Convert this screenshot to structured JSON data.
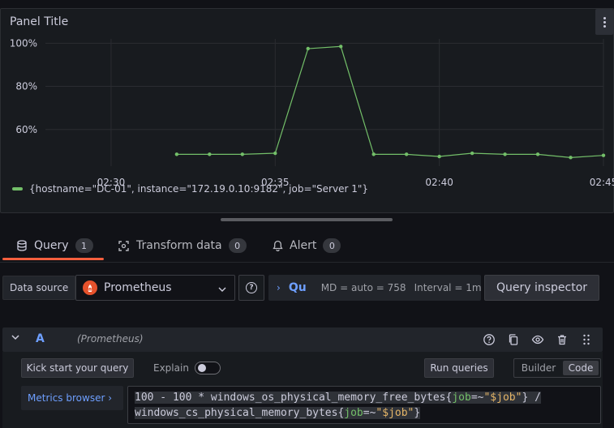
{
  "panel": {
    "title": "Panel Title",
    "legend_label": "{hostname=\"DC-01\", instance=\"172.19.0.10:9182\", job=\"Server 1\"}",
    "series_color": "#73bf69"
  },
  "chart_data": {
    "type": "line",
    "x": [
      "02:32",
      "02:33",
      "02:34",
      "02:35",
      "02:36",
      "02:37",
      "02:38",
      "02:39",
      "02:40",
      "02:41",
      "02:42",
      "02:43",
      "02:44",
      "02:45"
    ],
    "series": [
      {
        "name": "{hostname=\"DC-01\", instance=\"172.19.0.10:9182\", job=\"Server 1\"}",
        "values": [
          48.5,
          48.5,
          48.5,
          49,
          97.5,
          98.5,
          48.5,
          48.5,
          47.5,
          49,
          48.5,
          48.5,
          47,
          48
        ]
      }
    ],
    "x_ticks": [
      "02:30",
      "02:35",
      "02:40",
      "02:45"
    ],
    "y_ticks": [
      "60%",
      "80%",
      "100%"
    ],
    "ylim": [
      43,
      102
    ],
    "xlim": [
      "02:28",
      "02:45"
    ],
    "grid": true,
    "legend": "bottom-left"
  },
  "tabs": [
    {
      "label": "Query",
      "count": "1",
      "icon": "database-icon"
    },
    {
      "label": "Transform data",
      "count": "0",
      "icon": "transform-icon"
    },
    {
      "label": "Alert",
      "count": "0",
      "icon": "bell-icon"
    }
  ],
  "datasource": {
    "label": "Data source",
    "selected": "Prometheus",
    "query_options_title": "Qu",
    "md": "MD = auto = 758",
    "interval": "Interval = 1m",
    "inspector": "Query inspector"
  },
  "query": {
    "ref": "A",
    "datasource_name": "(Prometheus)",
    "kick_start": "Kick start your query",
    "explain": "Explain",
    "explain_on": false,
    "run": "Run queries",
    "mode_builder": "Builder",
    "mode_code": "Code",
    "mode_selected": "Code",
    "metrics_browser": "Metrics browser ›",
    "expr": {
      "p1": "100 - 100 * windows_os_physical_memory_free_bytes{",
      "l1": "job",
      "o1": "=~",
      "s1": "\"$job\"",
      "p2": "} /",
      "p3": "windows_cs_physical_memory_bytes{",
      "l2": "job",
      "o2": "=~",
      "s2": "\"$job\"",
      "p4": "}"
    }
  }
}
